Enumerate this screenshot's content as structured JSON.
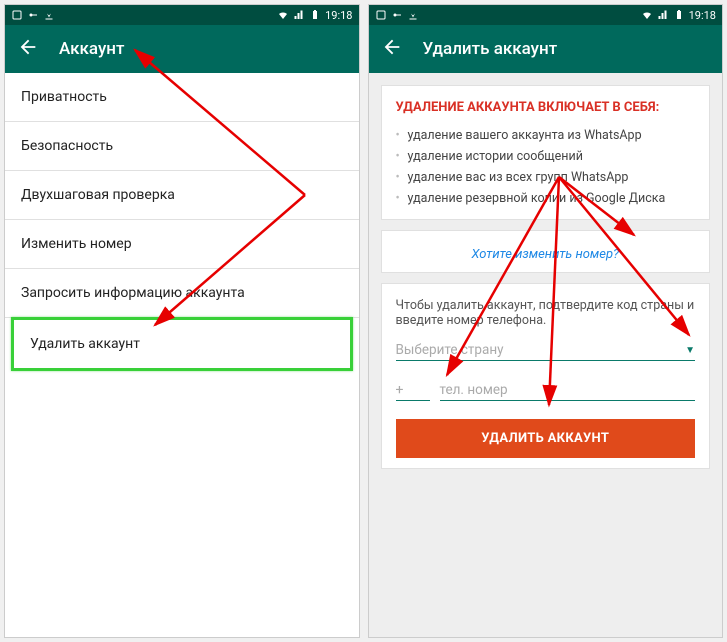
{
  "status": {
    "time": "19:18"
  },
  "screen1": {
    "title": "Аккаунт",
    "items": [
      "Приватность",
      "Безопасность",
      "Двухшаговая проверка",
      "Изменить номер",
      "Запросить информацию аккаунта",
      "Удалить аккаунт"
    ]
  },
  "screen2": {
    "title": "Удалить аккаунт",
    "warningTitle": "УДАЛЕНИЕ АККАУНТА ВКЛЮЧАЕТ В СЕБЯ:",
    "bullets": [
      "удаление вашего аккаунта из WhatsApp",
      "удаление истории сообщений",
      "удаление вас из всех групп WhatsApp",
      "удаление резервной копии из Google Диска"
    ],
    "changeNumberLink": "Хотите изменить номер?",
    "confirmText": "Чтобы удалить аккаунт, подтвердите код страны и введите номер телефона.",
    "countryPlaceholder": "Выберите страну",
    "plusPrefix": "+",
    "phonePlaceholder": "тел. номер",
    "deleteButton": "УДАЛИТЬ АККАУНТ"
  }
}
